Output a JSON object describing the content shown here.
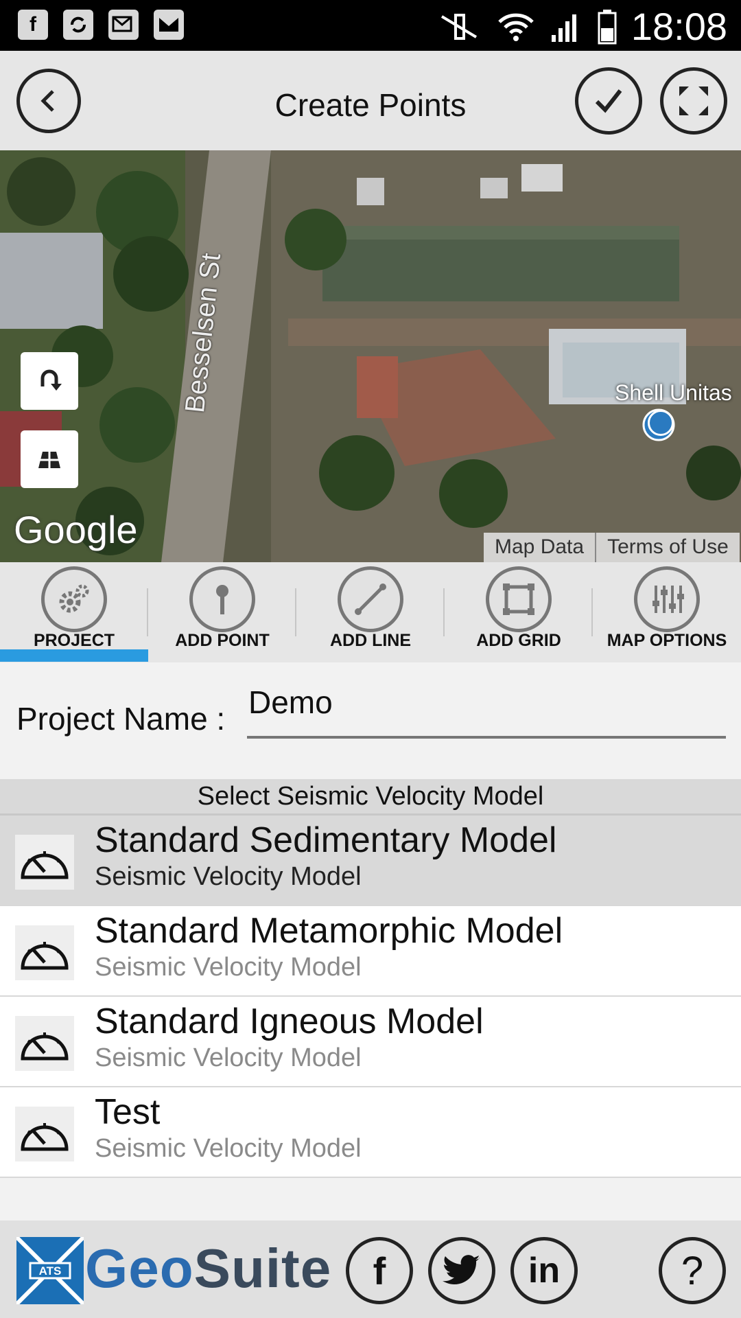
{
  "status_bar": {
    "time": "18:08",
    "left_icons": [
      "facebook-icon",
      "sync-icon",
      "email-sync-icon",
      "gmail-icon"
    ],
    "right_icons": [
      "mute-icon",
      "wifi-icon",
      "signal-icon",
      "battery-icon"
    ]
  },
  "header": {
    "title": "Create Points",
    "back_icon": "back-arrow-icon",
    "confirm_icon": "checkmark-icon",
    "fullscreen_icon": "expand-icon"
  },
  "map": {
    "street_label": "Besselsen St",
    "poi_label": "Shell Unitas",
    "google_label": "Google",
    "map_data_link": "Map Data",
    "terms_link": "Terms of Use",
    "map_type": "satellite"
  },
  "tabs": [
    {
      "label": "PROJECT",
      "icon": "gears-icon",
      "active": true
    },
    {
      "label": "ADD POINT",
      "icon": "pin-icon",
      "active": false
    },
    {
      "label": "ADD LINE",
      "icon": "line-icon",
      "active": false
    },
    {
      "label": "ADD GRID",
      "icon": "grid-square-icon",
      "active": false
    },
    {
      "label": "MAP OPTIONS",
      "icon": "sliders-icon",
      "active": false
    }
  ],
  "project": {
    "label": "Project Name :",
    "value": "Demo"
  },
  "velocity_models": {
    "heading": "Select Seismic Velocity Model",
    "items": [
      {
        "title": "Standard Sedimentary Model",
        "subtitle": "Seismic Velocity Model",
        "selected": true
      },
      {
        "title": "Standard Metamorphic Model",
        "subtitle": "Seismic Velocity Model",
        "selected": false
      },
      {
        "title": "Standard Igneous Model",
        "subtitle": "Seismic Velocity Model",
        "selected": false
      },
      {
        "title": "Test",
        "subtitle": "Seismic Velocity Model",
        "selected": false
      }
    ]
  },
  "footer": {
    "brand_geo": "Geo",
    "brand_suite": "Suite",
    "logo_initials": "ATS",
    "social": [
      "facebook-icon",
      "twitter-icon",
      "linkedin-icon"
    ],
    "help_icon": "help-icon",
    "brand_color": "#2a6bb0",
    "accent_color": "#2a9be0"
  }
}
